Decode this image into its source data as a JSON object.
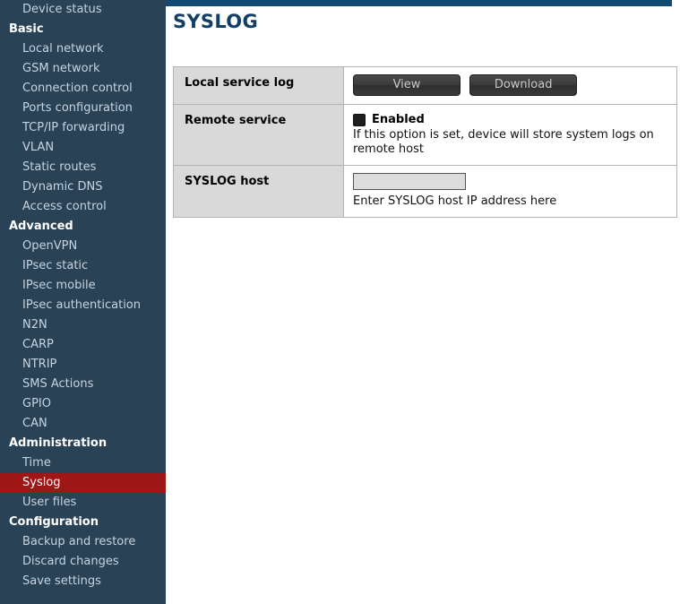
{
  "sidebar": {
    "entries": [
      {
        "type": "item",
        "label": "Device status",
        "active": false
      },
      {
        "type": "group",
        "label": "Basic"
      },
      {
        "type": "item",
        "label": "Local network",
        "active": false
      },
      {
        "type": "item",
        "label": "GSM network",
        "active": false
      },
      {
        "type": "item",
        "label": "Connection control",
        "active": false
      },
      {
        "type": "item",
        "label": "Ports configuration",
        "active": false
      },
      {
        "type": "item",
        "label": "TCP/IP forwarding",
        "active": false
      },
      {
        "type": "item",
        "label": "VLAN",
        "active": false
      },
      {
        "type": "item",
        "label": "Static routes",
        "active": false
      },
      {
        "type": "item",
        "label": "Dynamic DNS",
        "active": false
      },
      {
        "type": "item",
        "label": "Access control",
        "active": false
      },
      {
        "type": "group",
        "label": "Advanced"
      },
      {
        "type": "item",
        "label": "OpenVPN",
        "active": false
      },
      {
        "type": "item",
        "label": "IPsec static",
        "active": false
      },
      {
        "type": "item",
        "label": "IPsec mobile",
        "active": false
      },
      {
        "type": "item",
        "label": "IPsec authentication",
        "active": false
      },
      {
        "type": "item",
        "label": "N2N",
        "active": false
      },
      {
        "type": "item",
        "label": "CARP",
        "active": false
      },
      {
        "type": "item",
        "label": "NTRIP",
        "active": false
      },
      {
        "type": "item",
        "label": "SMS Actions",
        "active": false
      },
      {
        "type": "item",
        "label": "GPIO",
        "active": false
      },
      {
        "type": "item",
        "label": "CAN",
        "active": false
      },
      {
        "type": "group",
        "label": "Administration"
      },
      {
        "type": "item",
        "label": "Time",
        "active": false
      },
      {
        "type": "item",
        "label": "Syslog",
        "active": true
      },
      {
        "type": "item",
        "label": "User files",
        "active": false
      },
      {
        "type": "group",
        "label": "Configuration"
      },
      {
        "type": "item",
        "label": "Backup and restore",
        "active": false
      },
      {
        "type": "item",
        "label": "Discard changes",
        "active": false
      },
      {
        "type": "item",
        "label": "Save settings",
        "active": false
      }
    ]
  },
  "main": {
    "title": "SYSLOG",
    "rows": {
      "local_service_log": {
        "label": "Local service log",
        "view_button": "View",
        "download_button": "Download"
      },
      "remote_service": {
        "label": "Remote service",
        "checkbox_label": "Enabled",
        "hint": "If this option is set, device will store system logs on remote host",
        "checked": false
      },
      "syslog_host": {
        "label": "SYSLOG host",
        "value": "",
        "placeholder": "",
        "hint": "Enter SYSLOG host IP address here"
      }
    }
  },
  "colors": {
    "sidebar_bg": "#2a4256",
    "accent_bar": "#124a74",
    "active_item": "#9e1616",
    "title": "#123f63",
    "label_cell": "#d9d9d9"
  }
}
